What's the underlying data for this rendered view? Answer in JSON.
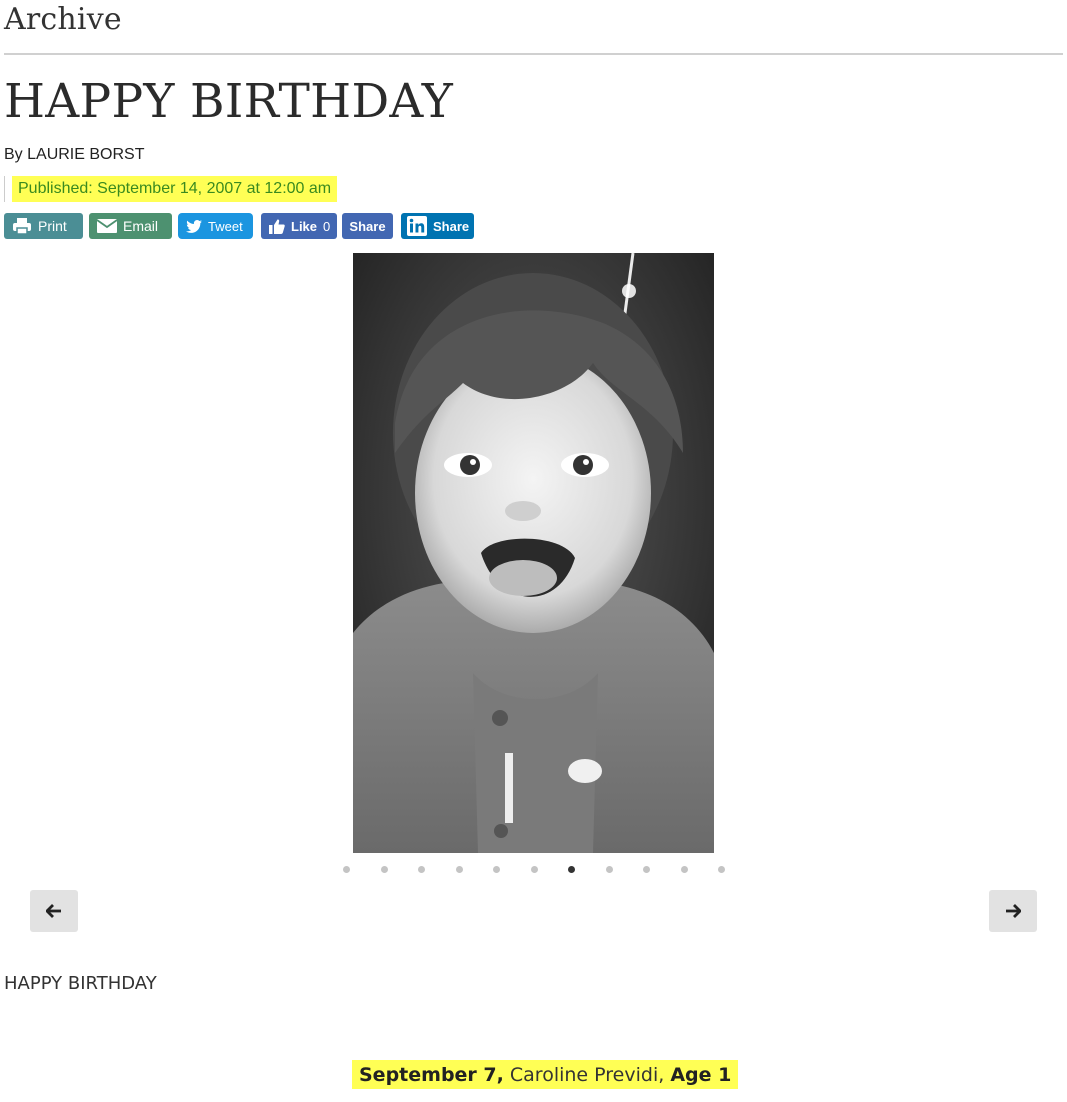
{
  "section": {
    "title": "Archive"
  },
  "article": {
    "headline": "HAPPY BIRTHDAY",
    "byline_prefix": "By",
    "author": "LAURIE BORST",
    "published": "Published: September 14, 2007 at 12:00 am",
    "body_heading": "HAPPY BIRTHDAY"
  },
  "share": {
    "print_label": "Print",
    "email_label": "Email",
    "tweet_label": "Tweet",
    "like_label": "Like",
    "like_count": "0",
    "fb_share_label": "Share",
    "linkedin_share_label": "Share"
  },
  "gallery": {
    "slide_count": 11,
    "active_slide_index": 6,
    "photo_icon": "baby-photo",
    "prev_icon": "arrow-left-icon",
    "next_icon": "arrow-right-icon"
  },
  "caption": {
    "date": "September 7,",
    "name": " Caroline Previdi, ",
    "age": "Age 1"
  },
  "colors": {
    "highlight": "#ffff55",
    "published_text": "#3a8a1f",
    "print_btn": "#4b8e95",
    "email_btn": "#4d9170",
    "twitter": "#1b95e0",
    "facebook": "#4267b2",
    "linkedin": "#0073b1"
  }
}
